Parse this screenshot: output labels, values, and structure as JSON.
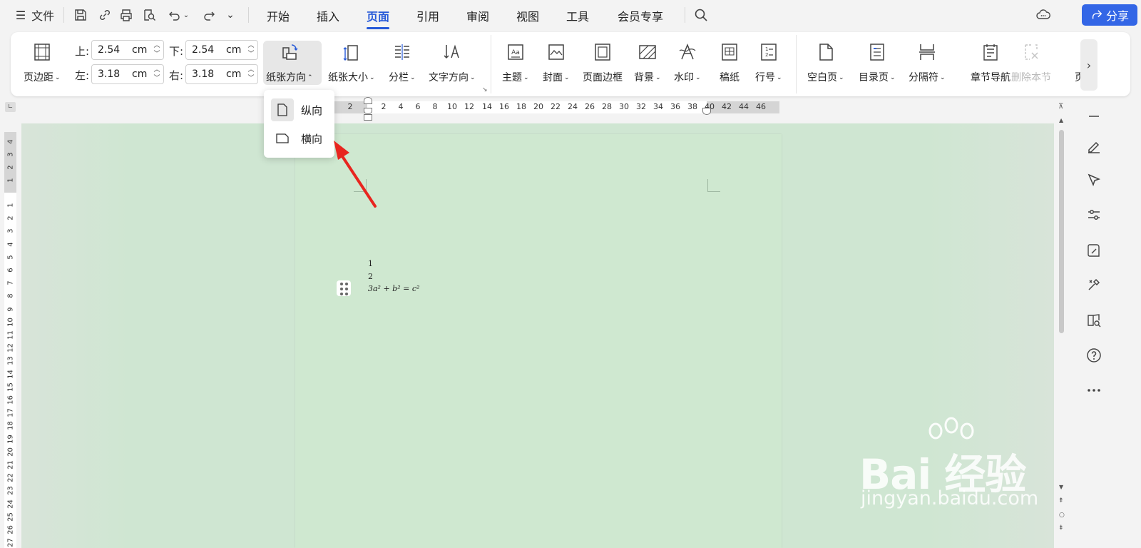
{
  "topbar": {
    "file_label": "文件",
    "tabs": [
      {
        "label": "开始",
        "active": false
      },
      {
        "label": "插入",
        "active": false
      },
      {
        "label": "页面",
        "active": true
      },
      {
        "label": "引用",
        "active": false
      },
      {
        "label": "审阅",
        "active": false
      },
      {
        "label": "视图",
        "active": false
      },
      {
        "label": "工具",
        "active": false
      },
      {
        "label": "会员专享",
        "active": false
      }
    ],
    "share_label": "分享",
    "accent": "#2659d8"
  },
  "ribbon": {
    "margins": {
      "label": "页边距",
      "top_label": "上:",
      "top_value": "2.54",
      "bottom_label": "下:",
      "bottom_value": "2.54",
      "left_label": "左:",
      "left_value": "3.18",
      "right_label": "右:",
      "right_value": "3.18",
      "unit": "cm"
    },
    "orientation": "纸张方向",
    "size": "纸张大小",
    "columns": "分栏",
    "text_direction": "文字方向",
    "theme": "主题",
    "cover": "封面",
    "page_border": "页面边框",
    "background": "背景",
    "watermark": "水印",
    "manuscript": "稿纸",
    "line_number": "行号",
    "blank_page": "空白页",
    "toc_page": "目录页",
    "separator": "分隔符",
    "section_nav": "章节导航",
    "delete_section": "删除本节",
    "more_truncated": "页"
  },
  "orientation_menu": {
    "portrait": "纵向",
    "landscape": "横向"
  },
  "ruler": {
    "h_ticks": [
      "4",
      "2",
      "2",
      "4",
      "6",
      "8",
      "10",
      "12",
      "14",
      "16",
      "18",
      "20",
      "22",
      "24",
      "26",
      "28",
      "30",
      "32",
      "34",
      "36",
      "38",
      "40",
      "42",
      "44",
      "46"
    ],
    "v_ticks": [
      "4",
      "3",
      "2",
      "1",
      "1",
      "2",
      "3",
      "4",
      "5",
      "6",
      "7",
      "8",
      "9",
      "10",
      "11",
      "12",
      "13",
      "14",
      "15",
      "16",
      "17",
      "18",
      "19",
      "20",
      "21",
      "22",
      "23",
      "24",
      "25",
      "26",
      "27"
    ]
  },
  "document": {
    "line1": "1",
    "line2": "2",
    "line3": "3a² + b² = c²"
  },
  "watermark": {
    "brand": "Bai 经验",
    "url": "jingyan.baidu.com"
  }
}
